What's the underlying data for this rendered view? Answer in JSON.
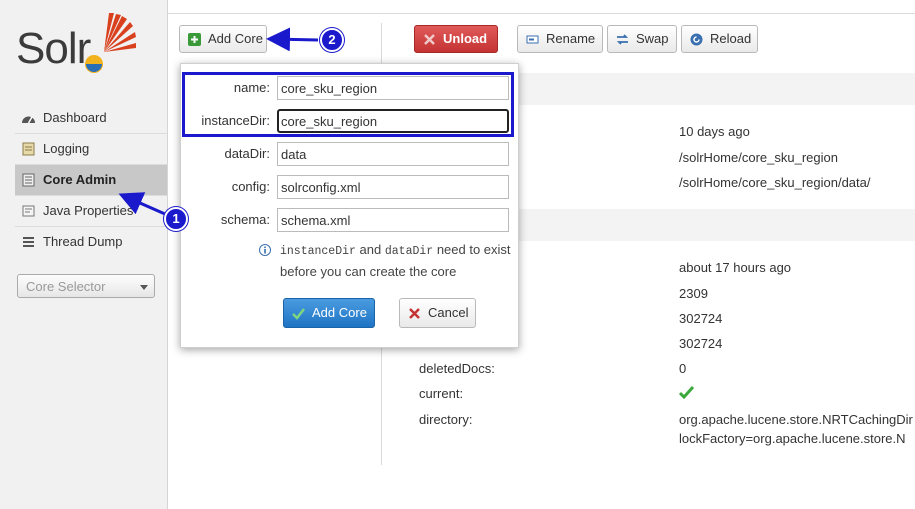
{
  "sidebar": {
    "logo_text": "Solr",
    "items": [
      {
        "label": "Dashboard",
        "icon": "dashboard-icon",
        "active": false
      },
      {
        "label": "Logging",
        "icon": "logging-icon",
        "active": false
      },
      {
        "label": "Core Admin",
        "icon": "core-admin-icon",
        "active": true
      },
      {
        "label": "Java Properties",
        "icon": "java-properties-icon",
        "active": false
      },
      {
        "label": "Thread Dump",
        "icon": "thread-dump-icon",
        "active": false
      }
    ],
    "core_selector": {
      "label": "Core Selector"
    }
  },
  "toolbar": {
    "add_core": "Add Core",
    "unload": "Unload",
    "rename": "Rename",
    "swap": "Swap",
    "reload": "Reload"
  },
  "dialog": {
    "fields": {
      "name": {
        "label": "name:",
        "value": "core_sku_region"
      },
      "instanceDir": {
        "label": "instanceDir:",
        "value": "core_sku_region"
      },
      "dataDir": {
        "label": "dataDir:",
        "value": "data"
      },
      "config": {
        "label": "config:",
        "value": "solrconfig.xml"
      },
      "schema": {
        "label": "schema:",
        "value": "schema.xml"
      }
    },
    "note": {
      "code1": "instanceDir",
      "and": "and",
      "code2": "dataDir",
      "rest": "need to exist before you can create the core"
    },
    "add_button": "Add Core",
    "cancel_button": "Cancel"
  },
  "core_info": {
    "values_top": [
      "10 days ago",
      "/solrHome/core_sku_region",
      "/solrHome/core_sku_region/data/"
    ],
    "index": {
      "rows": [
        {
          "key": "",
          "value": "about 17 hours ago"
        },
        {
          "key": "",
          "value": "2309"
        },
        {
          "key": "",
          "value": "302724"
        },
        {
          "key": "",
          "value": "302724"
        },
        {
          "key": "deletedDocs:",
          "value": "0"
        },
        {
          "key": "current:",
          "value": ""
        },
        {
          "key": "directory:",
          "value": "org.apache.lucene.store.NRTCachingDir"
        }
      ],
      "directory_line2": "lockFactory=org.apache.lucene.store.N"
    }
  },
  "annotations": {
    "badge1": "1",
    "badge2": "2",
    "color": "#1a1acc"
  },
  "colors": {
    "unload": "#c43333",
    "primary": "#1f74c4",
    "checkmark": "#3aa83a"
  }
}
